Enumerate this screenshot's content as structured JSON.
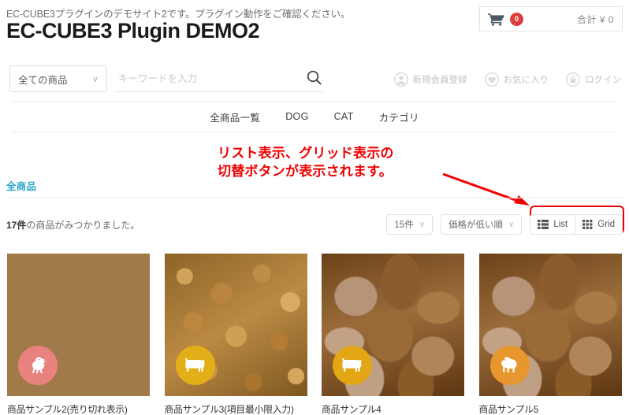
{
  "header": {
    "site_description": "EC-CUBE3プラグインのデモサイト2です。プラグイン動作をご確認ください。",
    "site_title": "EC-CUBE3 Plugin DEMO2",
    "cart": {
      "icon": "shopping-cart-icon",
      "count": "0",
      "total_label": "合計 ¥ 0",
      "badge_color": "#dc3e3e"
    }
  },
  "search": {
    "category_select": {
      "value": "全ての商品",
      "chevron": "∨"
    },
    "keyword_input": {
      "value": "",
      "placeholder": "キーワードを入力"
    },
    "search_button_icon": "search-icon"
  },
  "account_links": [
    {
      "label": "新規会員登録",
      "icon": "user-icon"
    },
    {
      "label": "お気に入り",
      "icon": "heart-icon"
    },
    {
      "label": "ログイン",
      "icon": "lock-icon"
    }
  ],
  "nav": {
    "items": [
      {
        "label": "全商品一覧"
      },
      {
        "label": "DOG"
      },
      {
        "label": "CAT"
      },
      {
        "label": "カテゴリ"
      }
    ]
  },
  "annotation": {
    "text": "リスト表示、グリッド表示の\n切替ボタンが表示されます。",
    "color": "#ef0000",
    "arrow": "points from annotation text down-right to the List/Grid buttons",
    "highlight_target": "view-switch-buttons"
  },
  "category": {
    "heading": "全商品",
    "heading_color": "#27a6c9"
  },
  "results": {
    "count_prefix": "17件",
    "count_suffix": "の商品がみつかりました。",
    "per_page_select": {
      "value": "15件",
      "chevron": "∨"
    },
    "sort_select": {
      "value": "価格が低い順",
      "chevron": "∨"
    },
    "view_buttons": [
      {
        "label": "List",
        "icon": "list-view-icon"
      },
      {
        "label": "Grid",
        "icon": "grid-view-icon"
      }
    ]
  },
  "products": [
    {
      "title": "商品サンプル2(売り切れ表示)",
      "badge_icon": "chicken-icon",
      "badge_color": "#e8827f",
      "image_style": "kibble-a"
    },
    {
      "title": "商品サンプル3(項目最小限入力)",
      "badge_icon": "cow-icon",
      "badge_color": "#e3af18",
      "image_style": "kibble-b"
    },
    {
      "title": "商品サンプル4",
      "badge_icon": "cow-icon",
      "badge_color": "#e3a716",
      "image_style": "meat"
    },
    {
      "title": "商品サンプル5",
      "badge_icon": "horse-icon",
      "badge_color": "#e8962e",
      "image_style": "meat"
    }
  ]
}
